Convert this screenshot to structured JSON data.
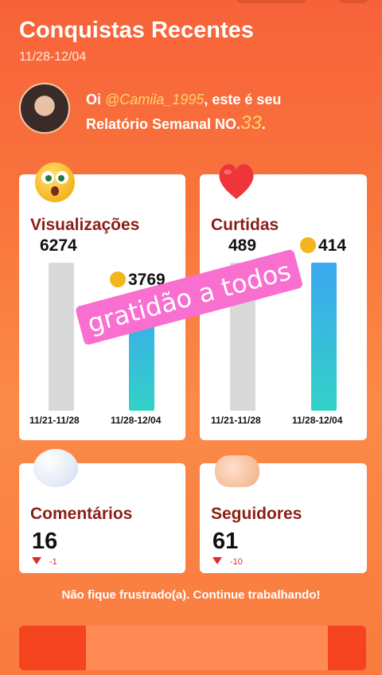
{
  "header": {
    "title": "Conquistas Recentes",
    "date_range": "11/28-12/04"
  },
  "greeting": {
    "prefix": "Oi ",
    "handle": "@Camila_1995",
    "suffix": ", este é seu",
    "report_label": "Relatório Semanal NO.",
    "report_number": "33",
    "report_end": "."
  },
  "views": {
    "label": "Visualizações",
    "previous_value": "6274",
    "current_value": "3769",
    "previous_period": "11/21-11/28",
    "current_period": "11/28-12/04",
    "icon": "surprised-face-icon"
  },
  "likes": {
    "label": "Curtidas",
    "previous_value": "489",
    "current_value": "414",
    "previous_period": "11/21-11/28",
    "current_period": "11/28-12/04",
    "icon": "heart-icon"
  },
  "comments": {
    "label": "Comentários",
    "value": "16",
    "delta": "-1",
    "icon": "speech-bubble-icon"
  },
  "followers": {
    "label": "Seguidores",
    "value": "61",
    "delta": "-10",
    "icon": "handshake-icon"
  },
  "sticker": {
    "text": "gratidão a todos"
  },
  "footer": {
    "message": "Não fique frustrado(a). Continue trabalhando!"
  },
  "colors": {
    "background": "#f9743c",
    "label_dark_red": "#8a1f16",
    "accent_yellow": "#ffd36b",
    "bar_current_top": "#3aa8f0",
    "bar_current_bottom": "#33d1c7",
    "bar_previous": "#d9d9d9",
    "sticker_pink": "#f86fd0",
    "delta_red": "#e02a2a"
  }
}
